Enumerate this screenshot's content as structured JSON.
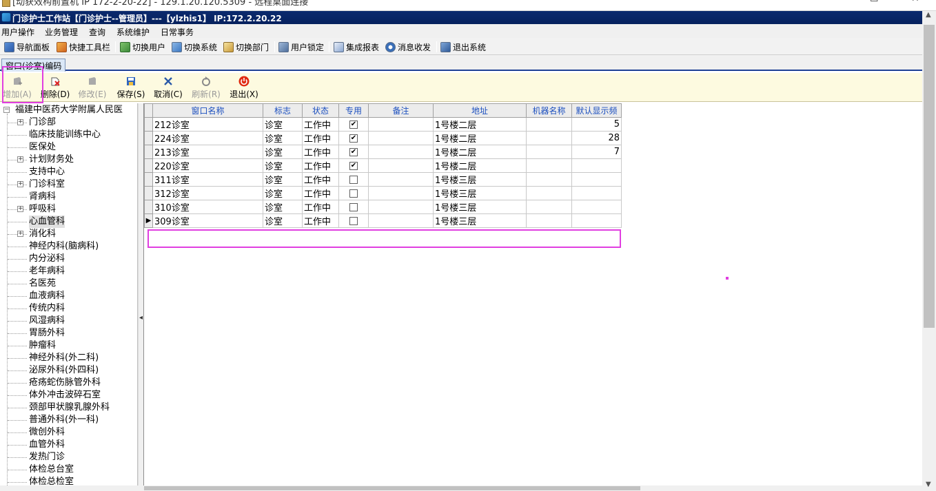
{
  "remote": {
    "title": "[动获效构前置机 IP 172-2-20-22] - 129.1.20.120.5309 - 远程桌面连接"
  },
  "window": {
    "title": "门诊护士工作站【门诊护士--管理员】---【ylzhis1】 IP:172.2.20.22"
  },
  "menu": [
    "用户操作",
    "业务管理",
    "查询",
    "系统维护",
    "日常事务"
  ],
  "toolbar": [
    {
      "label": "导航面板",
      "icon": "navigation-panel-icon"
    },
    {
      "label": "快捷工具栏",
      "icon": "quick-toolbar-icon"
    },
    {
      "label": "切换用户",
      "icon": "switch-user-icon"
    },
    {
      "label": "切换系统",
      "icon": "switch-system-icon"
    },
    {
      "label": "切换部门",
      "icon": "switch-department-icon"
    },
    {
      "label": "用户锁定",
      "icon": "user-lock-icon"
    },
    {
      "label": "集成报表",
      "icon": "report-icon"
    },
    {
      "label": "消息收发",
      "icon": "message-icon"
    },
    {
      "label": "退出系统",
      "icon": "exit-system-icon"
    }
  ],
  "tab": {
    "label": "窗口(诊室)编码"
  },
  "actions": [
    {
      "label": "增加(A)",
      "enabled": false
    },
    {
      "label": "删除(D)",
      "enabled": true
    },
    {
      "label": "修改(E)",
      "enabled": false
    },
    {
      "label": "保存(S)",
      "enabled": true
    },
    {
      "label": "取消(C)",
      "enabled": true
    },
    {
      "label": "刷新(R)",
      "enabled": false
    },
    {
      "label": "退出(X)",
      "enabled": true
    }
  ],
  "tree": {
    "root": "福建中医药大学附属人民医",
    "items": [
      {
        "label": "门诊部",
        "expandable": true
      },
      {
        "label": "临床技能训练中心",
        "expandable": false
      },
      {
        "label": "医保处",
        "expandable": false
      },
      {
        "label": "计划财务处",
        "expandable": true
      },
      {
        "label": "支持中心",
        "expandable": false
      },
      {
        "label": "门诊科室",
        "expandable": true
      },
      {
        "label": "肾病科",
        "expandable": false
      },
      {
        "label": "呼吸科",
        "expandable": true
      },
      {
        "label": "心血管科",
        "expandable": false,
        "selected": true
      },
      {
        "label": "消化科",
        "expandable": true
      },
      {
        "label": "神经内科(脑病科)",
        "expandable": false
      },
      {
        "label": "内分泌科",
        "expandable": false
      },
      {
        "label": "老年病科",
        "expandable": false
      },
      {
        "label": "名医苑",
        "expandable": false
      },
      {
        "label": "血液病科",
        "expandable": false
      },
      {
        "label": "传统内科",
        "expandable": false
      },
      {
        "label": "风湿病科",
        "expandable": false
      },
      {
        "label": "胃肠外科",
        "expandable": false
      },
      {
        "label": "肿瘤科",
        "expandable": false
      },
      {
        "label": "神经外科(外二科)",
        "expandable": false
      },
      {
        "label": "泌尿外科(外四科)",
        "expandable": false
      },
      {
        "label": "疮疡蛇伤脉管外科",
        "expandable": false
      },
      {
        "label": "体外冲击波碎石室",
        "expandable": false
      },
      {
        "label": "颈部甲状腺乳腺外科",
        "expandable": false
      },
      {
        "label": "普通外科(外一科)",
        "expandable": false
      },
      {
        "label": "微创外科",
        "expandable": false
      },
      {
        "label": "血管外科",
        "expandable": false
      },
      {
        "label": "发热门诊",
        "expandable": false
      },
      {
        "label": "体检总台室",
        "expandable": false
      },
      {
        "label": "体检总检室",
        "expandable": false
      }
    ]
  },
  "grid": {
    "columns": [
      "窗口名称",
      "标志",
      "状态",
      "专用",
      "备注",
      "地址",
      "机器名称",
      "默认显示频"
    ],
    "rows": [
      {
        "name": "212诊室",
        "flag": "诊室",
        "status": "工作中",
        "dedicated": true,
        "note": "",
        "address": "1号楼二层",
        "machine": "",
        "freq": "5"
      },
      {
        "name": "224诊室",
        "flag": "诊室",
        "status": "工作中",
        "dedicated": true,
        "note": "",
        "address": "1号楼二层",
        "machine": "",
        "freq": "28"
      },
      {
        "name": "213诊室",
        "flag": "诊室",
        "status": "工作中",
        "dedicated": true,
        "note": "",
        "address": "1号楼二层",
        "machine": "",
        "freq": "7"
      },
      {
        "name": "220诊室",
        "flag": "诊室",
        "status": "工作中",
        "dedicated": true,
        "note": "",
        "address": "1号楼二层",
        "machine": "",
        "freq": ""
      },
      {
        "name": "311诊室",
        "flag": "诊室",
        "status": "工作中",
        "dedicated": false,
        "note": "",
        "address": "1号楼三层",
        "machine": "",
        "freq": ""
      },
      {
        "name": "312诊室",
        "flag": "诊室",
        "status": "工作中",
        "dedicated": false,
        "note": "",
        "address": "1号楼三层",
        "machine": "",
        "freq": ""
      },
      {
        "name": "310诊室",
        "flag": "诊室",
        "status": "工作中",
        "dedicated": false,
        "note": "",
        "address": "1号楼三层",
        "machine": "",
        "freq": ""
      },
      {
        "name": "309诊室",
        "flag": "诊室",
        "status": "工作中",
        "dedicated": false,
        "note": "",
        "address": "1号楼三层",
        "machine": "",
        "freq": "",
        "current": true
      }
    ]
  },
  "colors": {
    "titlebar": "#0b2a6e",
    "header_text": "#1b4fbf",
    "action_bg": "#fdfae0",
    "highlight": "#e03ee0"
  }
}
